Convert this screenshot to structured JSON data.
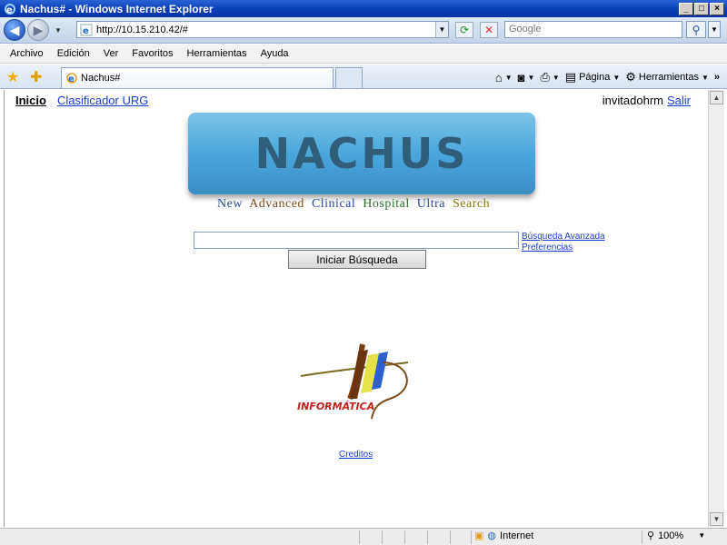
{
  "window": {
    "title": "Nachus# - Windows Internet Explorer",
    "min_label": "_",
    "max_label": "□",
    "close_label": "×"
  },
  "address": {
    "url": "http://10.15.210.42/#",
    "search_placeholder": "Google"
  },
  "menu": [
    "Archivo",
    "Edición",
    "Ver",
    "Favoritos",
    "Herramientas",
    "Ayuda"
  ],
  "tab": {
    "label": "Nachus#"
  },
  "command_bar": {
    "page_label": "Página",
    "tools_label": "Herramientas"
  },
  "nav": {
    "home_label": "Inicio",
    "classifier_label": "Clasificador URG",
    "user": "invitadohrm",
    "logout_label": "Salir"
  },
  "logo": {
    "text": "NACHUS",
    "tagline": [
      "New",
      "Advanced",
      "Clinical",
      "Hospital",
      "Ultra",
      "Search"
    ]
  },
  "search": {
    "advanced_label": "Búsqueda Avanzada",
    "prefs_label": "Preferencias",
    "submit_label": "Iniciar Búsqueda"
  },
  "footer": {
    "informatica_text": "INFORMÁTICA",
    "credits_label": "Creditos"
  },
  "status": {
    "zone": "Internet",
    "zoom": "100%"
  },
  "colors": {
    "link": "#1a3fd6",
    "title_bar": "#0a3fb8",
    "logo_blue": "#4aa7dc",
    "logo_text": "#2f5d7a"
  }
}
